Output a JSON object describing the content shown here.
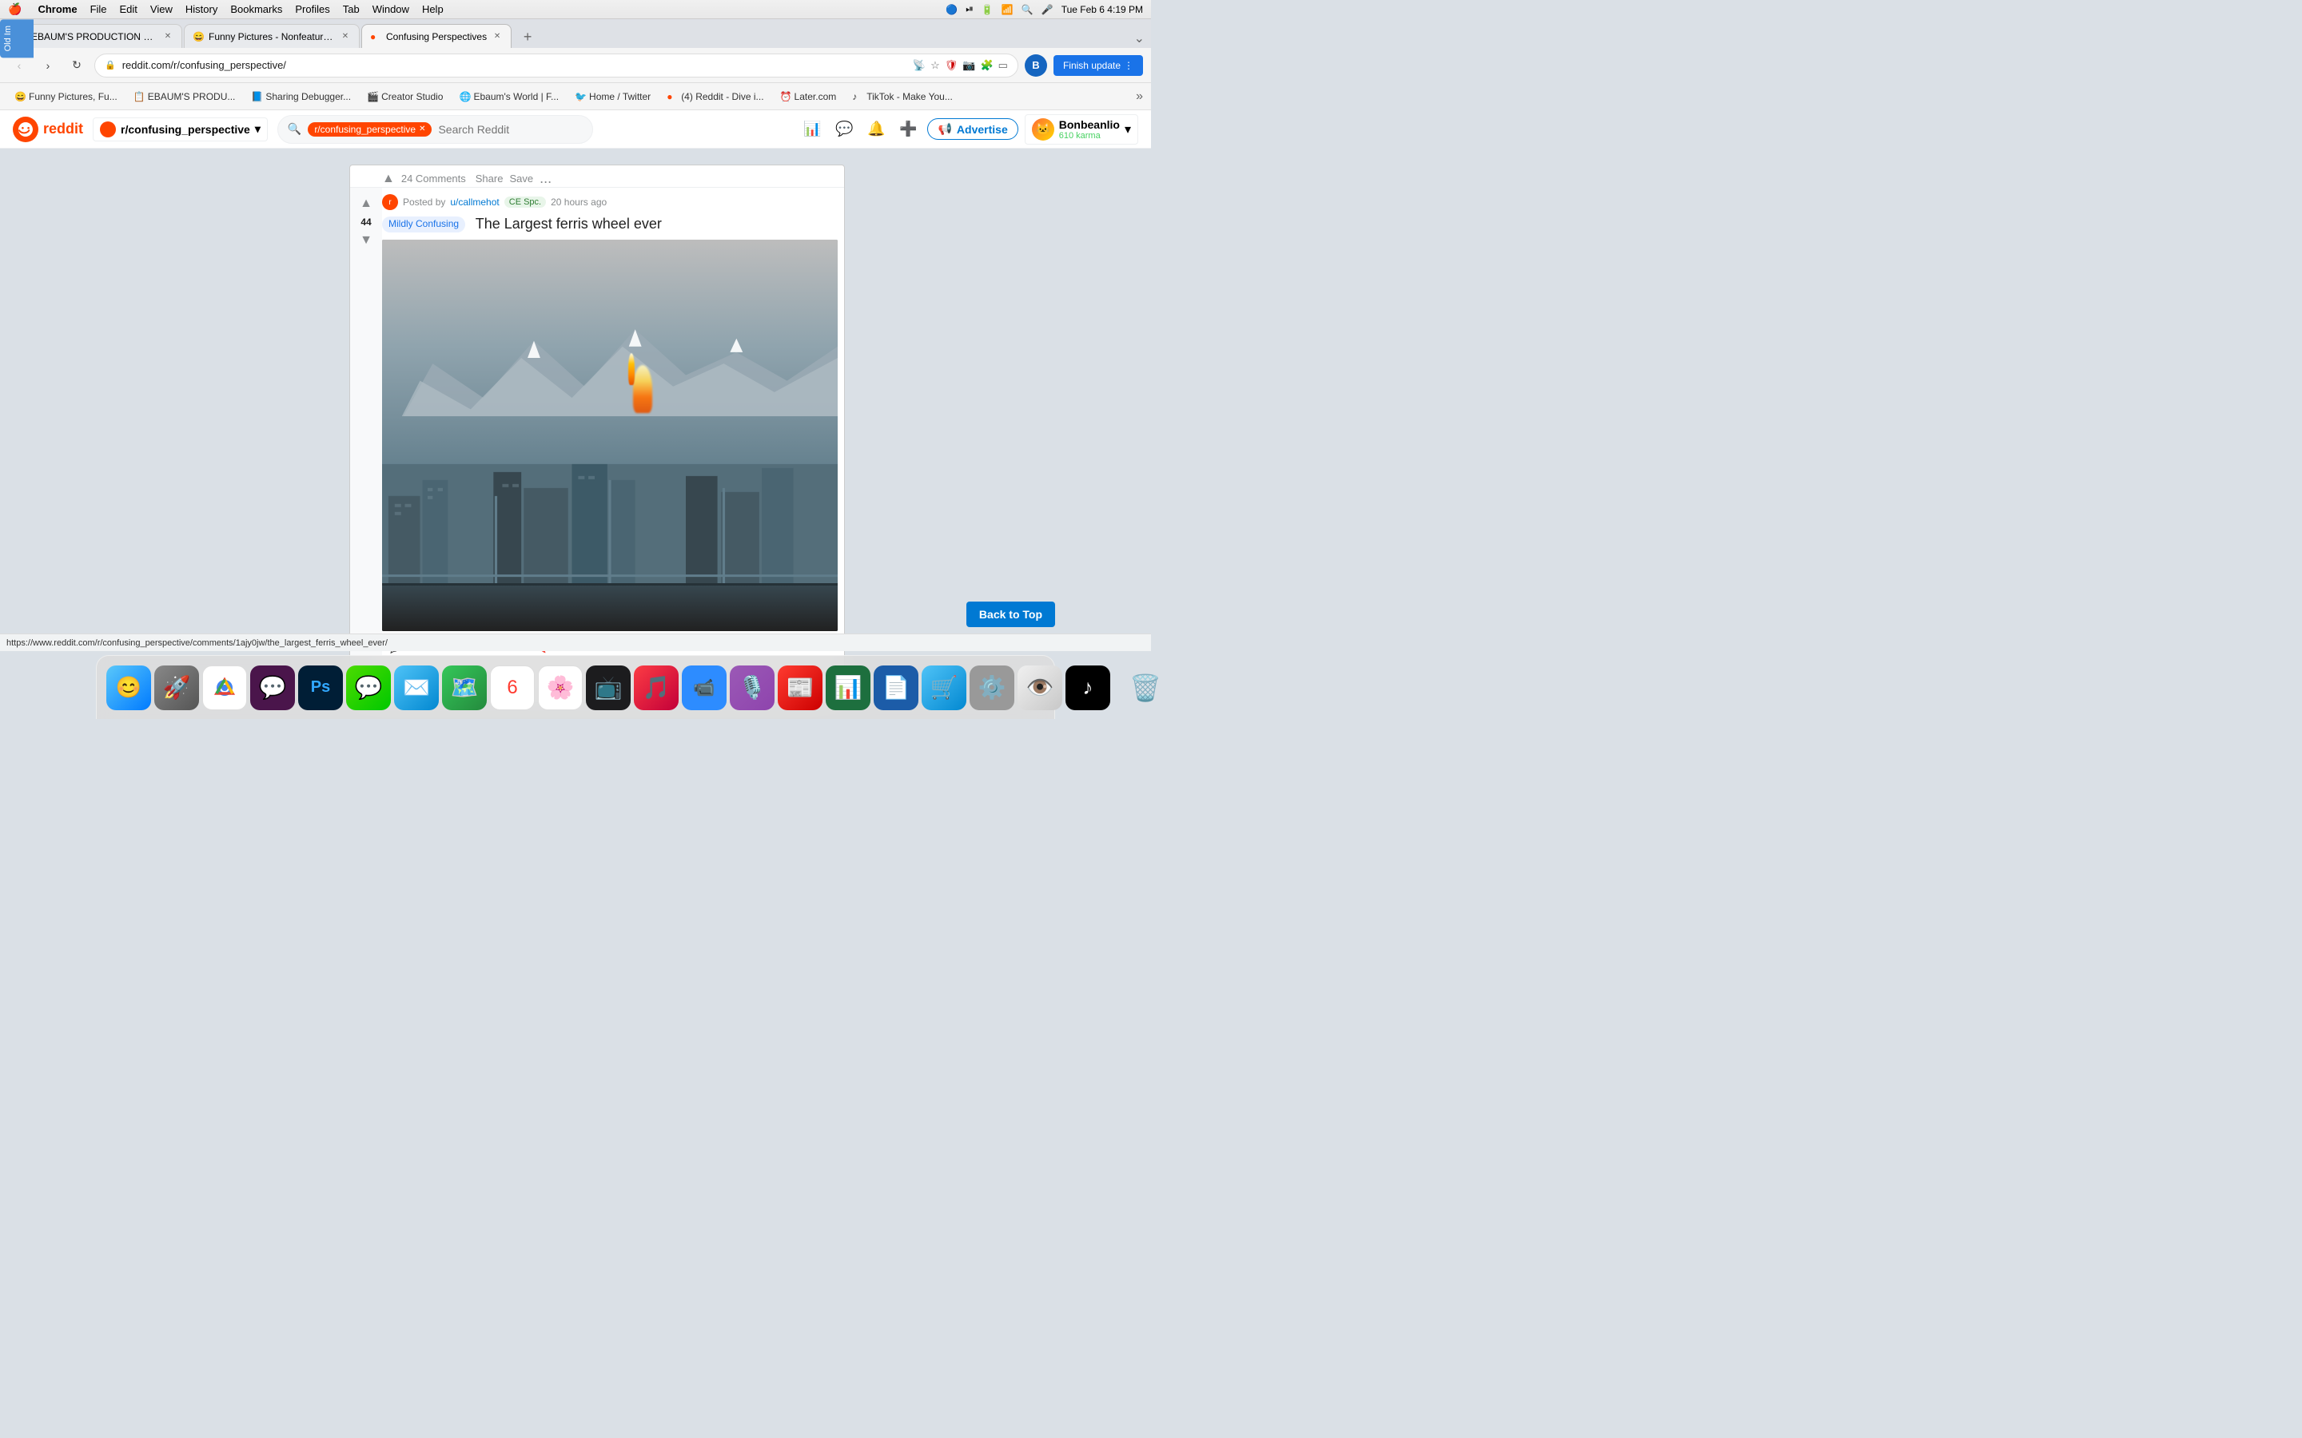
{
  "menubar": {
    "apple": "🍎",
    "app_name": "Chrome",
    "items": [
      "File",
      "Edit",
      "View",
      "History",
      "Bookmarks",
      "Profiles",
      "Tab",
      "Window",
      "Help"
    ],
    "right": {
      "datetime": "Tue Feb 6  4:19 PM"
    }
  },
  "browser": {
    "tabs": [
      {
        "id": "tab1",
        "label": "EBAUM'S PRODUCTION SCH...",
        "favicon": "🎭",
        "active": false
      },
      {
        "id": "tab2",
        "label": "Funny Pictures - Nonfeature...",
        "favicon": "😄",
        "active": false
      },
      {
        "id": "tab3",
        "label": "Confusing Perspectives",
        "favicon": "🔴",
        "active": true
      }
    ],
    "url": "reddit.com/r/confusing_perspective/",
    "finish_update_label": "Finish update"
  },
  "bookmarks": [
    {
      "label": "Funny Pictures, Fu...",
      "favicon": "😄"
    },
    {
      "label": "EBAUM'S PRODU...",
      "favicon": "🎭"
    },
    {
      "label": "Sharing Debugger...",
      "favicon": "📘"
    },
    {
      "label": "Creator Studio",
      "favicon": "🎬"
    },
    {
      "label": "Ebaum's World | F...",
      "favicon": "🌐"
    },
    {
      "label": "Home / Twitter",
      "favicon": "🐦"
    },
    {
      "label": "(4) Reddit - Dive i...",
      "favicon": "🔴"
    },
    {
      "label": "Later.com",
      "favicon": "⏰"
    },
    {
      "label": "TikTok - Make You...",
      "favicon": "♪"
    }
  ],
  "reddit": {
    "nav": {
      "subreddit": "r/confusing_perspective",
      "search_placeholder": "Search Reddit",
      "search_tag": "r/confusing_perspective",
      "advertise_label": "Advertise",
      "user": {
        "name": "Bonbeanlio",
        "karma": "610 karma"
      }
    },
    "post": {
      "vote_count": "44",
      "meta": {
        "subreddit": "r/confusing_perspective",
        "posted_by": "Posted by",
        "author": "u/callmehot",
        "flair": "CE Spc.",
        "time": "20 hours ago"
      },
      "flair_label": "Mildly Confusing",
      "title": "The Largest ferris wheel ever",
      "actions": {
        "comments": "24 Comments",
        "share": "Share",
        "save": "Save",
        "more": "..."
      }
    }
  },
  "back_to_top": "Back to Top",
  "status_bar": {
    "url": "https://www.reddit.com/r/confusing_perspective/comments/1ajy0jw/the_largest_ferris_wheel_ever/"
  },
  "old_image_tab": "Old Im",
  "dock": {
    "icons": [
      {
        "name": "Finder",
        "emoji": "😊"
      },
      {
        "name": "Launchpad",
        "emoji": "🚀"
      },
      {
        "name": "Chrome",
        "emoji": "🌐"
      },
      {
        "name": "Slack",
        "emoji": "💬"
      },
      {
        "name": "Photoshop",
        "emoji": "Ps"
      },
      {
        "name": "Messages",
        "emoji": "💬"
      },
      {
        "name": "Mail",
        "emoji": "✉️"
      },
      {
        "name": "Maps",
        "emoji": "🗺️"
      },
      {
        "name": "Calendar",
        "emoji": "📅"
      },
      {
        "name": "Photos",
        "emoji": "🌸"
      },
      {
        "name": "Apple TV",
        "emoji": "📺"
      },
      {
        "name": "Music",
        "emoji": "🎵"
      },
      {
        "name": "Zoom",
        "emoji": "📹"
      },
      {
        "name": "Podcasts",
        "emoji": "🎙️"
      },
      {
        "name": "News",
        "emoji": "📰"
      },
      {
        "name": "Numbers",
        "emoji": "📊"
      },
      {
        "name": "Pages",
        "emoji": "📄"
      },
      {
        "name": "App Store",
        "emoji": "🛒"
      },
      {
        "name": "System Preferences",
        "emoji": "⚙️"
      },
      {
        "name": "Preview",
        "emoji": "👁️"
      },
      {
        "name": "TikTok",
        "emoji": "♪"
      },
      {
        "name": "Trash",
        "emoji": "🗑️"
      }
    ]
  }
}
